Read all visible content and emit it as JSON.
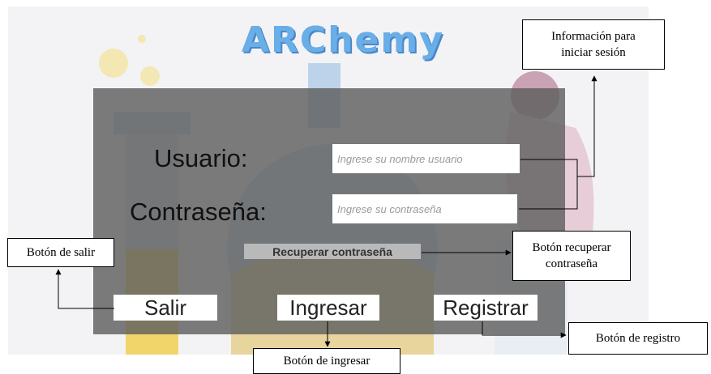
{
  "app": {
    "title": "ARChemy"
  },
  "login": {
    "user_label": "Usuario:",
    "user_placeholder": "Ingrese su nombre usuario",
    "password_label": "Contraseña:",
    "password_placeholder": "Ingrese su contraseña",
    "recover_label": "Recuperar contraseña",
    "exit_label": "Salir",
    "login_label": "Ingresar",
    "register_label": "Registrar"
  },
  "annotations": {
    "login_info": "Información para iniciar sesión",
    "exit_button": "Botón de salir",
    "recover_button": "Botón recuperar contraseña",
    "login_button": "Botón de ingresar",
    "register_button": "Botón de registro"
  },
  "colors": {
    "panel": "#5f5f5f",
    "logo": "#6aaee8",
    "background": "#f3f3f5"
  }
}
